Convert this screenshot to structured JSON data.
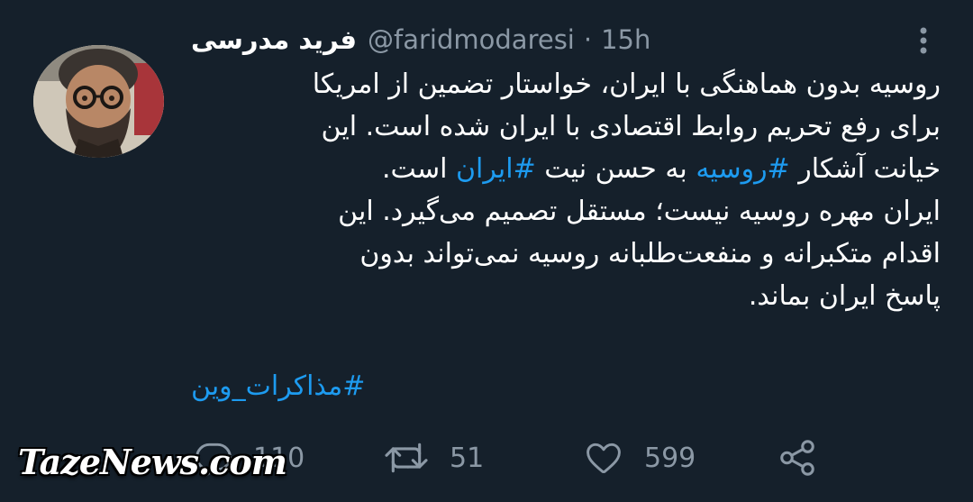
{
  "colors": {
    "background": "#15202b",
    "text": "#ffffff",
    "muted": "#8b98a5",
    "link": "#1d9bf0"
  },
  "tweet": {
    "author_name": "فرید مدرسی",
    "handle": "@faridmodaresi",
    "separator": "·",
    "time": "15h",
    "lines": [
      {
        "text": "روسیه بدون هماهنگی با ایران، خواستار تضمین از امریکا"
      },
      {
        "text": "برای رفع تحریم روابط اقتصادی با ایران شده است. این"
      },
      {
        "pre": "خیانت آشکار ",
        "tag1": "#روسیه",
        "mid": " به حسن نیت ",
        "tag2": "#ایران",
        "post": " است."
      },
      {
        "text": "ایران مهره روسیه نیست؛ مستقل تصمیم می‌گیرد. این"
      },
      {
        "text": "اقدام متکبرانه و منفعت‌طلبانه روسیه نمی‌تواند بدون"
      },
      {
        "text": "پاسخ ایران بماند."
      }
    ],
    "hashtag": "#مذاکرات_وین"
  },
  "actions": {
    "reply_count": "110",
    "retweet_count": "51",
    "like_count": "599",
    "icons": [
      "reply-icon",
      "retweet-icon",
      "like-icon",
      "share-icon"
    ]
  },
  "watermark": "TazeNews.com"
}
